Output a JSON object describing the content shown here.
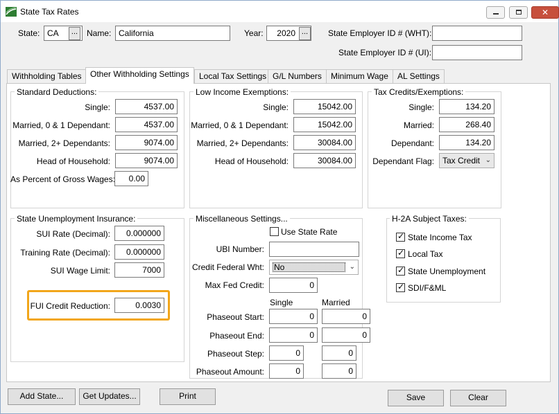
{
  "window": {
    "title": "State Tax Rates",
    "minimize_glyph": "–",
    "maximize_glyph": "□",
    "close_glyph": "✕"
  },
  "header": {
    "state_label": "State:",
    "state_value": "CA",
    "browse_glyph": "...",
    "name_label": "Name:",
    "name_value": "California",
    "year_label": "Year:",
    "year_value": "2020",
    "employer_wht_label": "State Employer ID # (WHT):",
    "employer_wht_value": "",
    "employer_ui_label": "State Employer ID # (UI):",
    "employer_ui_value": ""
  },
  "tabs": [
    {
      "label": "Withholding Tables",
      "active": false
    },
    {
      "label": "Other Withholding Settings",
      "active": true
    },
    {
      "label": "Local Tax Settings",
      "active": false
    },
    {
      "label": "G/L Numbers",
      "active": false
    },
    {
      "label": "Minimum Wage",
      "active": false
    },
    {
      "label": "AL Settings",
      "active": false
    }
  ],
  "standard_deductions": {
    "title": "Standard Deductions:",
    "single_label": "Single:",
    "single_value": "4537.00",
    "married01_label": "Married, 0 & 1 Dependant:",
    "married01_value": "4537.00",
    "married2_label": "Married, 2+ Dependants:",
    "married2_value": "9074.00",
    "hoh_label": "Head of Household:",
    "hoh_value": "9074.00",
    "pct_label": "As Percent of Gross Wages:",
    "pct_value": "0.00"
  },
  "low_income": {
    "title": "Low Income Exemptions:",
    "single_label": "Single:",
    "single_value": "15042.00",
    "married01_label": "Married, 0 & 1 Dependant:",
    "married01_value": "15042.00",
    "married2_label": "Married, 2+ Dependants:",
    "married2_value": "30084.00",
    "hoh_label": "Head of Household:",
    "hoh_value": "30084.00"
  },
  "tax_credits": {
    "title": "Tax Credits/Exemptions:",
    "single_label": "Single:",
    "single_value": "134.20",
    "married_label": "Married:",
    "married_value": "268.40",
    "dependant_label": "Dependant:",
    "dependant_value": "134.20",
    "flag_label": "Dependant Flag:",
    "flag_value": "Tax Credit"
  },
  "sui": {
    "title": "State Unemployment Insurance:",
    "rate_label": "SUI Rate (Decimal):",
    "rate_value": "0.000000",
    "training_label": "Training Rate (Decimal):",
    "training_value": "0.000000",
    "wage_limit_label": "SUI Wage Limit:",
    "wage_limit_value": "7000",
    "fui_label": "FUI Credit Reduction:",
    "fui_value": "0.0030"
  },
  "misc": {
    "title": "Miscellaneous Settings...",
    "use_state_rate_label": "Use State Rate",
    "ubi_label": "UBI Number:",
    "ubi_value": "",
    "credit_fed_label": "Credit Federal Wht:",
    "credit_fed_value": "No",
    "max_fed_label": "Max Fed Credit:",
    "max_fed_value": "0",
    "single_header": "Single",
    "married_header": "Married",
    "phaseout_start_label": "Phaseout Start:",
    "phaseout_start_single": "0",
    "phaseout_start_married": "0",
    "phaseout_end_label": "Phaseout End:",
    "phaseout_end_single": "0",
    "phaseout_end_married": "0",
    "phaseout_step_label": "Phaseout Step:",
    "phaseout_step_single": "0",
    "phaseout_step_married": "0",
    "phaseout_amount_label": "Phaseout Amount:",
    "phaseout_amount_single": "0",
    "phaseout_amount_married": "0"
  },
  "h2a": {
    "title": "H-2A Subject Taxes:",
    "state_income": "State Income Tax",
    "local": "Local Tax",
    "state_unemployment": "State Unemployment",
    "sdi": "SDI/F&ML",
    "check_glyph": "✓"
  },
  "buttons": {
    "add_state": "Add State...",
    "get_updates": "Get Updates...",
    "print": "Print",
    "save": "Save",
    "clear": "Clear"
  },
  "colors": {
    "highlight": "#f2a61b",
    "close_button": "#c7503d"
  }
}
